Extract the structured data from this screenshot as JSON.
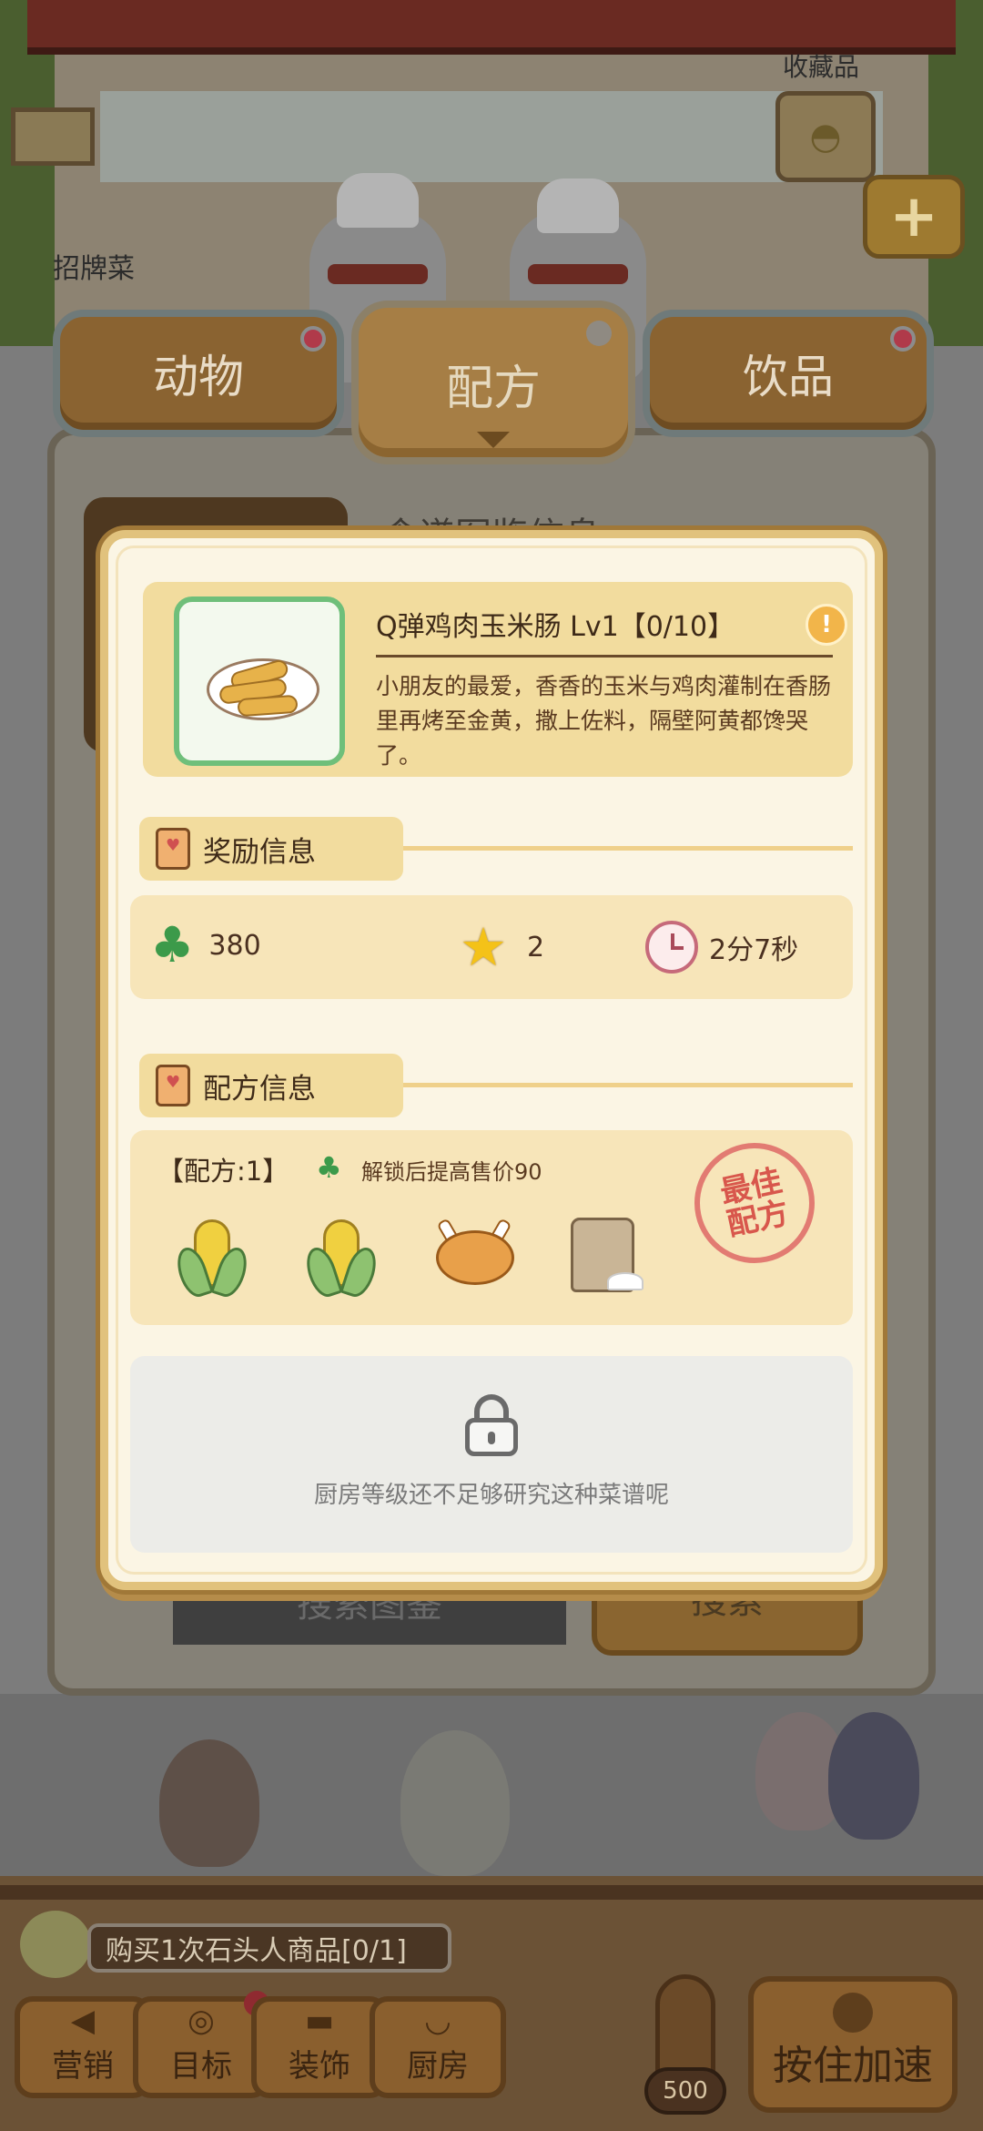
{
  "background": {
    "collection_label": "收藏品",
    "signature_label": "招牌菜"
  },
  "tabs": [
    {
      "label": "动物",
      "has_dot": true
    },
    {
      "label": "配方",
      "active": true
    },
    {
      "label": "饮品",
      "has_dot": true
    }
  ],
  "behind_panel": {
    "title": "食谱图鉴信息",
    "search_button": "搜索图鉴",
    "confirm_button": "搜索"
  },
  "item": {
    "title": "Q弹鸡肉玉米肠 Lv1【0/10】",
    "description": "小朋友的最爱，香香的玉米与鸡肉灌制在香肠里再烤至金黄，撒上佐料，隔壁阿黄都馋哭了。",
    "info_icon": "lightbulb-icon"
  },
  "reward_section": {
    "title": "奖励信息",
    "clover_value": "380",
    "star_value": "2",
    "time_value": "2分7秒"
  },
  "recipe_section": {
    "title": "配方信息",
    "recipe_label": "【配方:1】",
    "bonus_text": "解锁后提高售价90",
    "ingredients": [
      "corn",
      "corn",
      "roast-chicken",
      "flour-bag"
    ],
    "stamp_text": "最佳配方"
  },
  "locked": {
    "message": "厨房等级还不足够研究这种菜谱呢"
  },
  "hud": {
    "task_text": "购买1次石头人商品[0/1]",
    "buttons": [
      {
        "label": "营销",
        "icon": "megaphone-icon"
      },
      {
        "label": "目标",
        "icon": "target-icon",
        "has_dot": true
      },
      {
        "label": "装饰",
        "icon": "paint-roller-icon"
      },
      {
        "label": "厨房",
        "icon": "wok-icon"
      }
    ],
    "thermometer_value": "500",
    "speed_button": "按住加速"
  },
  "colors": {
    "dialog_bg": "#fbf5e4",
    "dialog_border": "#e1c27d",
    "section_bg": "#f7e5b9",
    "clover": "#3c9a4a",
    "star": "#f4c218",
    "stamp": "#d8574c"
  }
}
